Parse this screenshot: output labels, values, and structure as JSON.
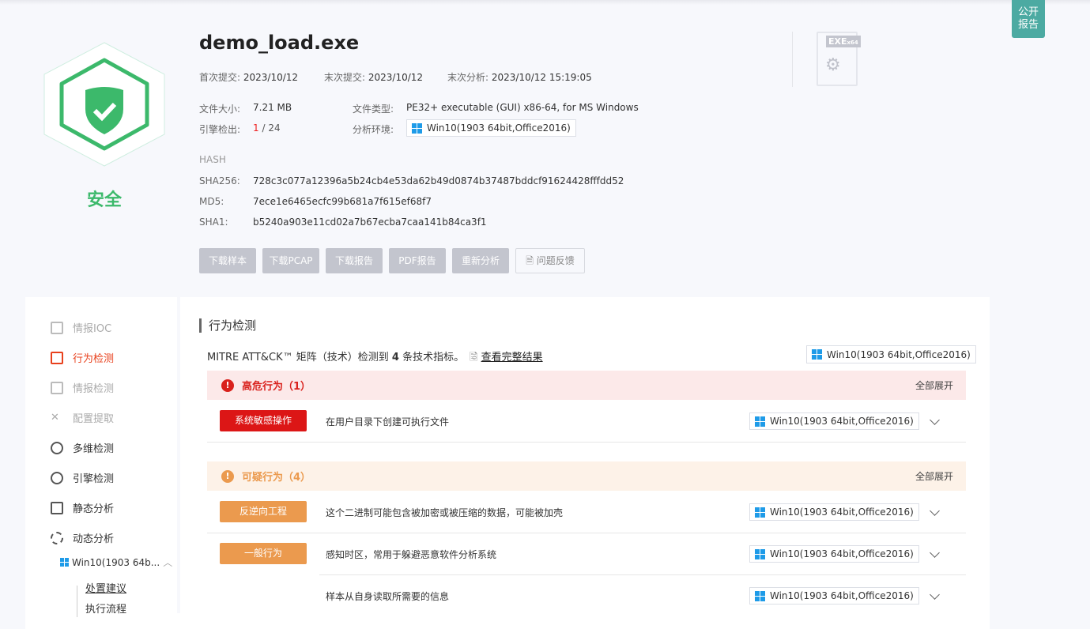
{
  "public_report": "公开\n报告",
  "verdict": {
    "label": "安全",
    "color": "#3cb96b"
  },
  "file": {
    "name": "demo_load.exe",
    "first_submit_label": "首次提交:",
    "first_submit": "2023/10/12",
    "last_submit_label": "末次提交:",
    "last_submit": "2023/10/12",
    "last_analysis_label": "末次分析:",
    "last_analysis": "2023/10/12 15:19:05",
    "size_label": "文件大小:",
    "size": "7.21 MB",
    "type_label": "文件类型:",
    "type": "PE32+ executable (GUI) x86-64, for MS Windows",
    "engine_label": "引擎检出:",
    "engine_hits": "1",
    "engine_total": "/ 24",
    "env_label": "分析环境:",
    "env": "Win10(1903 64bit,Office2016)",
    "icon_text": "EXE",
    "icon_sub": "x64"
  },
  "hash": {
    "heading": "HASH",
    "sha256_label": "SHA256:",
    "sha256": "728c3c077a12396a5b24cb4e53da62b49d0874b37487bddcf91624428fffdd52",
    "md5_label": "MD5:",
    "md5": "7ece1e6465ecfc99b681a7f615ef68f7",
    "sha1_label": "SHA1:",
    "sha1": "b5240a903e11cd02a7b67ecba7caa141b84ca3f1"
  },
  "actions": [
    "下载样本",
    "下载PCAP",
    "下载报告",
    "PDF报告",
    "重新分析",
    "问题反馈"
  ],
  "sidebar": {
    "items": [
      {
        "label": "情报IOC",
        "state": "disabled"
      },
      {
        "label": "行为检测",
        "state": "active"
      },
      {
        "label": "情报检测",
        "state": "disabled"
      },
      {
        "label": "配置提取",
        "state": "disabled"
      },
      {
        "label": "多维检测",
        "state": "normal"
      },
      {
        "label": "引擎检测",
        "state": "normal"
      },
      {
        "label": "静态分析",
        "state": "normal"
      },
      {
        "label": "动态分析",
        "state": "normal"
      }
    ],
    "env": "Win10(1903 64b...",
    "sub": [
      "处置建议",
      "执行流程"
    ]
  },
  "main": {
    "title": "行为检测",
    "summary_pre": "MITRE ATT&CK™ 矩阵（技术）检测到 ",
    "summary_count": "4",
    "summary_post": " 条技术指标。",
    "full_link": "查看完整结果",
    "env": "Win10(1903 64bit,Office2016)",
    "expand_all": "全部展开",
    "high": {
      "title": "高危行为（1）",
      "color": "#d9211c",
      "bg": "#fce9e9",
      "rows": [
        {
          "tag": "系统敏感操作",
          "desc": "在用户目录下创建可执行文件",
          "env": "Win10(1903 64bit,Office2016)"
        }
      ]
    },
    "suspicious": {
      "title": "可疑行为（4）",
      "color": "#eb9a4e",
      "bg": "#fdf2e8",
      "rows": [
        {
          "tag": "反逆向工程",
          "desc": "这个二进制可能包含被加密或被压缩的数据，可能被加壳",
          "env": "Win10(1903 64bit,Office2016)"
        },
        {
          "tag": "一般行为",
          "desc": "感知时区，常用于躲避恶意软件分析系统",
          "env": "Win10(1903 64bit,Office2016)"
        },
        {
          "tag": "",
          "desc": "样本从自身读取所需要的信息",
          "env": "Win10(1903 64bit,Office2016)"
        }
      ]
    }
  }
}
